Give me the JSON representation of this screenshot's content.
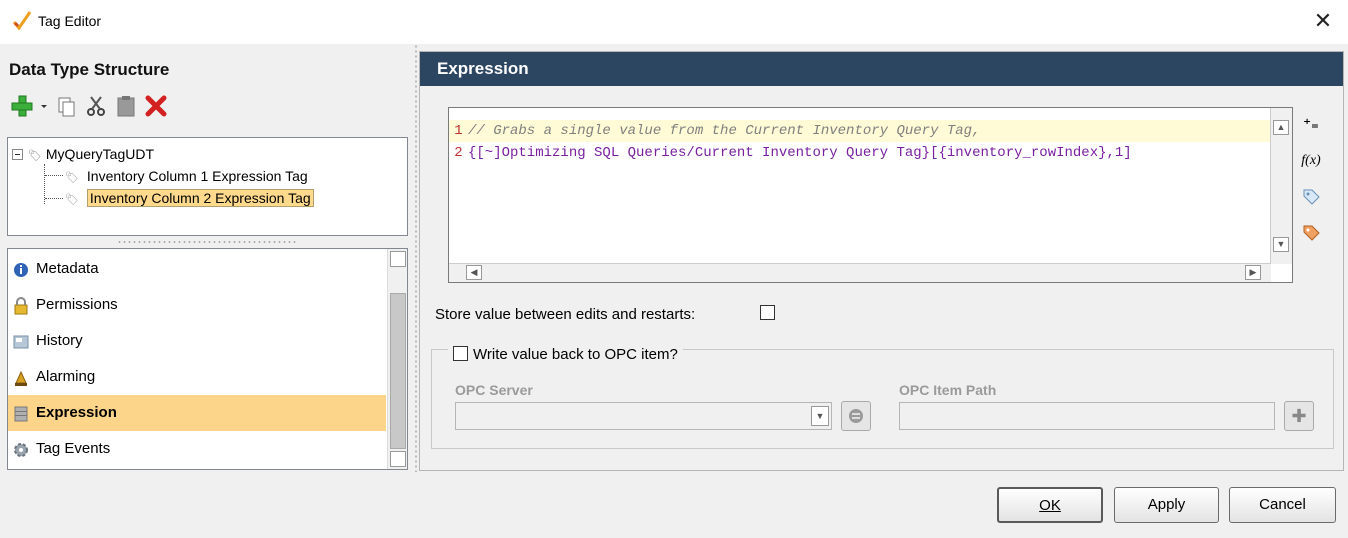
{
  "window": {
    "title": "Tag Editor",
    "close_icon": "close-icon",
    "app_icon": "checkmark-brush-icon"
  },
  "left": {
    "title": "Data Type Structure",
    "toolbar": [
      {
        "name": "add-icon",
        "tooltip": ""
      },
      {
        "name": "dropdown-arrow-icon"
      },
      {
        "name": "copy-icon"
      },
      {
        "name": "cut-icon"
      },
      {
        "name": "paste-icon"
      },
      {
        "name": "delete-icon"
      }
    ],
    "tree": {
      "root": "MyQueryTagUDT",
      "children": [
        "Inventory Column 1 Expression Tag",
        "Inventory Column 2 Expression Tag"
      ],
      "selected_index": 1
    },
    "menu": [
      {
        "label": "Metadata",
        "icon": "info-icon"
      },
      {
        "label": "Permissions",
        "icon": "lock-icon"
      },
      {
        "label": "History",
        "icon": "history-icon"
      },
      {
        "label": "Alarming",
        "icon": "alarm-bell-icon"
      },
      {
        "label": "Expression",
        "icon": "database-icon",
        "active": true
      },
      {
        "label": "Tag Events",
        "icon": "gear-icon"
      }
    ]
  },
  "right": {
    "header": "Expression",
    "editor": {
      "lines": [
        {
          "num": "1",
          "text": "// Grabs a single value from the Current Inventory Query Tag,",
          "type": "comment"
        },
        {
          "num": "2",
          "text": "{[~]Optimizing SQL Queries/Current Inventory Query Tag}[{inventory_rowIndex},1]",
          "type": "code"
        }
      ],
      "side_icons": [
        "operators-icon",
        "function-icon",
        "tag-icon",
        "udt-tag-icon"
      ]
    },
    "store_label": "Store value between edits and restarts:",
    "store_checked": false,
    "opc": {
      "legend": "Write value back to OPC item?",
      "checked": false,
      "server_label": "OPC Server",
      "server_value": "",
      "path_label": "OPC Item Path",
      "path_value": ""
    }
  },
  "buttons": {
    "ok": "OK",
    "apply": "Apply",
    "cancel": "Cancel"
  }
}
